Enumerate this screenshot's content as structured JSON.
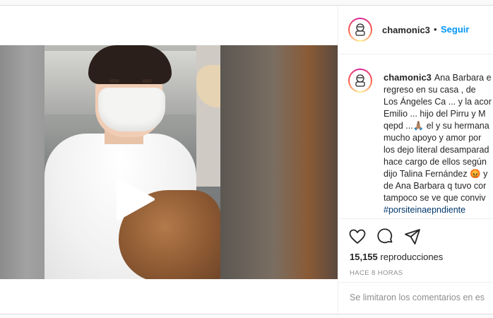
{
  "post": {
    "username": "chamonic3",
    "separator": "•",
    "follow_label": "Seguir",
    "caption_lines": [
      "Ana Barbara e",
      "regreso en su casa , de",
      "Los Ángeles Ca ... y la acor",
      "Emilio ... hijo del Pirru y M",
      "qepd ...🙏🏽 el y su hermana",
      "mucho apoyo y amor por",
      "los dejo literal desamparad",
      "hace cargo de ellos según",
      "dijo Talina Fernández 😡 y",
      "de Ana Barbara q tuvo cor",
      "tampoco se ve que conviv"
    ],
    "hashtag_partial": "#porsiteinaepndiente",
    "views_count": "15,155",
    "views_label": "reproducciones",
    "timestamp": "HACE 8 HORAS",
    "comments_limited": "Se limitaron los comentarios en es"
  },
  "icons": {
    "play": "play-icon",
    "like": "heart-icon",
    "comment": "comment-icon",
    "share": "share-icon",
    "avatar": "avatar-icon"
  },
  "colors": {
    "follow": "#0095f6",
    "muted": "#8e8e8e",
    "text": "#262626"
  }
}
